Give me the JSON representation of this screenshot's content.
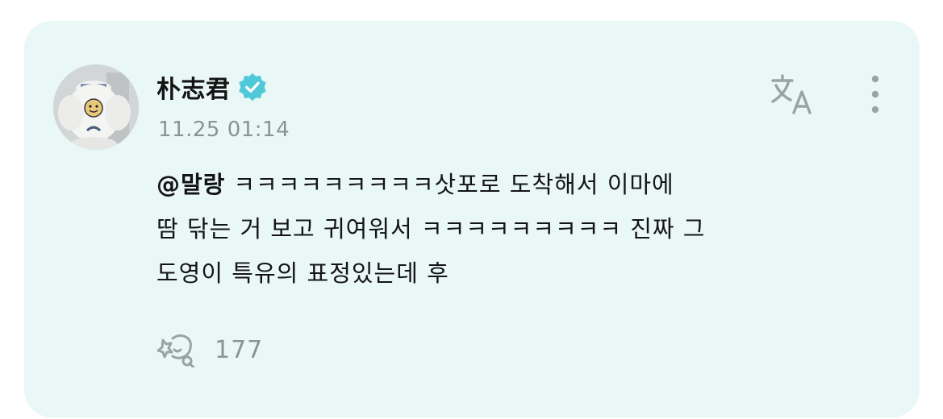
{
  "post": {
    "author": {
      "name": "朴志君",
      "verified": true,
      "verified_color": "#4fc9d9"
    },
    "timestamp": "11.25 01:14",
    "mention": "@말랑",
    "text_line_1": "ㅋㅋㅋㅋㅋㅋㅋㅋㅋ삿포로 도착해서 이마에",
    "text_line_2": "땀 닦는 거 보고 귀여워서 ㅋㅋㅋㅋㅋㅋㅋㅋㅋ 진짜 그",
    "text_line_3": "도영이 특유의 표정있는데 후",
    "like_count": "177"
  },
  "icons": {
    "translate": "translate-icon",
    "more": "more-vertical-icon",
    "like": "like-icon",
    "verified": "verified-badge-icon"
  },
  "colors": {
    "card_background": "#e9f8f6",
    "secondary_text": "#8a9392",
    "primary_text": "#141414",
    "icon_gray": "#9aa3a2"
  }
}
